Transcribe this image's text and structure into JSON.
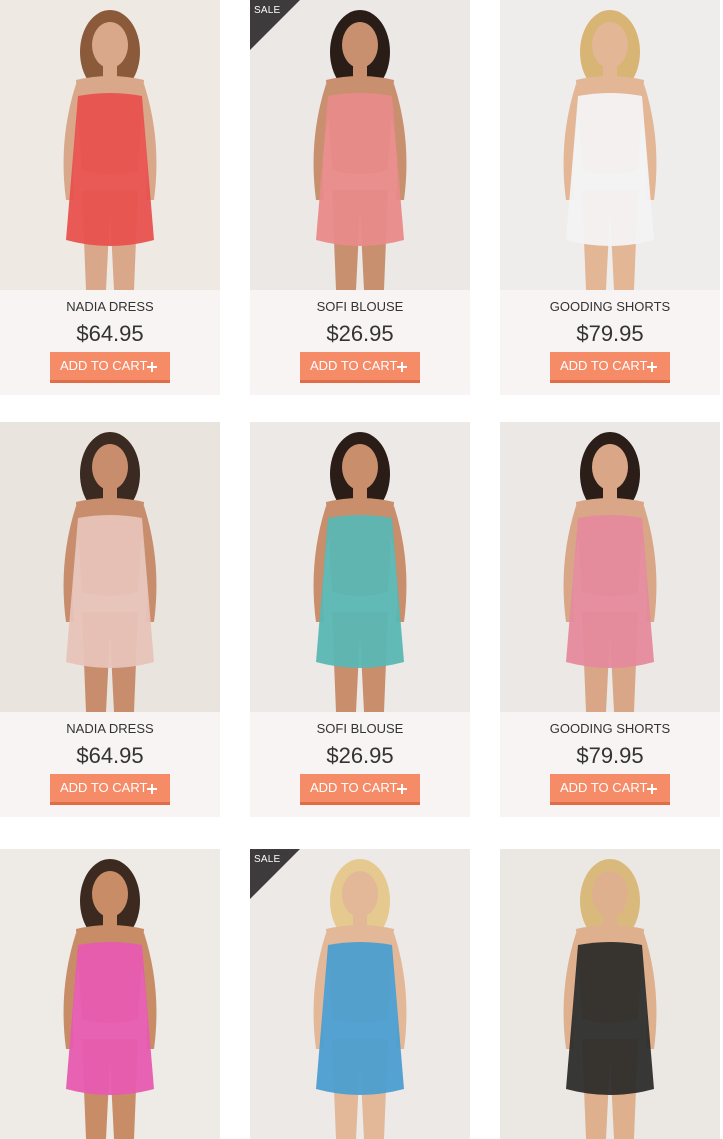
{
  "products": [
    {
      "name": "NADIA DRESS",
      "price": "$64.95",
      "cart_label": "ADD TO CART",
      "sale": "",
      "bg": "#efe9e4",
      "garment": "#e8514d",
      "skin": "#d9a88a",
      "hair": "#8a5a3a",
      "image_icon": "red-dress-photo"
    },
    {
      "name": "SOFI BLOUSE",
      "price": "$26.95",
      "cart_label": "ADD TO CART",
      "sale": "SALE",
      "bg": "#ebe8e6",
      "garment": "#e98b8a",
      "skin": "#c9906f",
      "hair": "#2a1d18",
      "image_icon": "floral-dress-photo"
    },
    {
      "name": "GOODING SHORTS",
      "price": "$79.95",
      "cart_label": "ADD TO CART",
      "sale": "",
      "bg": "#efedeb",
      "garment": "#f3f3f3",
      "skin": "#e3b696",
      "hair": "#d8b574",
      "image_icon": "white-top-photo"
    },
    {
      "name": "NADIA DRESS",
      "price": "$64.95",
      "cart_label": "ADD TO CART",
      "sale": "",
      "bg": "#eae4df",
      "garment": "#e8c3b8",
      "skin": "#c78d6c",
      "hair": "#3a2a22",
      "image_icon": "backless-top-photo"
    },
    {
      "name": "SOFI BLOUSE",
      "price": "$26.95",
      "cart_label": "ADD TO CART",
      "sale": "",
      "bg": "#ede9e6",
      "garment": "#5bb7b4",
      "skin": "#c98e6c",
      "hair": "#2a1c16",
      "image_icon": "bikini-photo"
    },
    {
      "name": "GOODING SHORTS",
      "price": "$79.95",
      "cart_label": "ADD TO CART",
      "sale": "",
      "bg": "#ece8e5",
      "garment": "#e58a9c",
      "skin": "#d9a687",
      "hair": "#2b1d18",
      "image_icon": "pink-peplum-photo"
    },
    {
      "name": "",
      "price": "",
      "cart_label": "",
      "sale": "",
      "bg": "#eeeae6",
      "garment": "#e75bb0",
      "skin": "#c88c66",
      "hair": "#3c2a20",
      "image_icon": "pink-bikini-back-photo"
    },
    {
      "name": "",
      "price": "",
      "cart_label": "",
      "sale": "SALE",
      "bg": "#ece9e7",
      "garment": "#4b9ed0",
      "skin": "#e2b898",
      "hair": "#e5c98f",
      "image_icon": "blue-blouse-photo"
    },
    {
      "name": "",
      "price": "",
      "cart_label": "",
      "sale": "",
      "bg": "#ebe8e4",
      "garment": "#2d2d2b",
      "skin": "#deb08e",
      "hair": "#d9ba7c",
      "image_icon": "black-tank-photo"
    }
  ],
  "colors": {
    "button": "#f68b68",
    "button_shadow": "#e06d48",
    "card_bg": "#f7f4f3",
    "badge": "#3d3b3b"
  }
}
